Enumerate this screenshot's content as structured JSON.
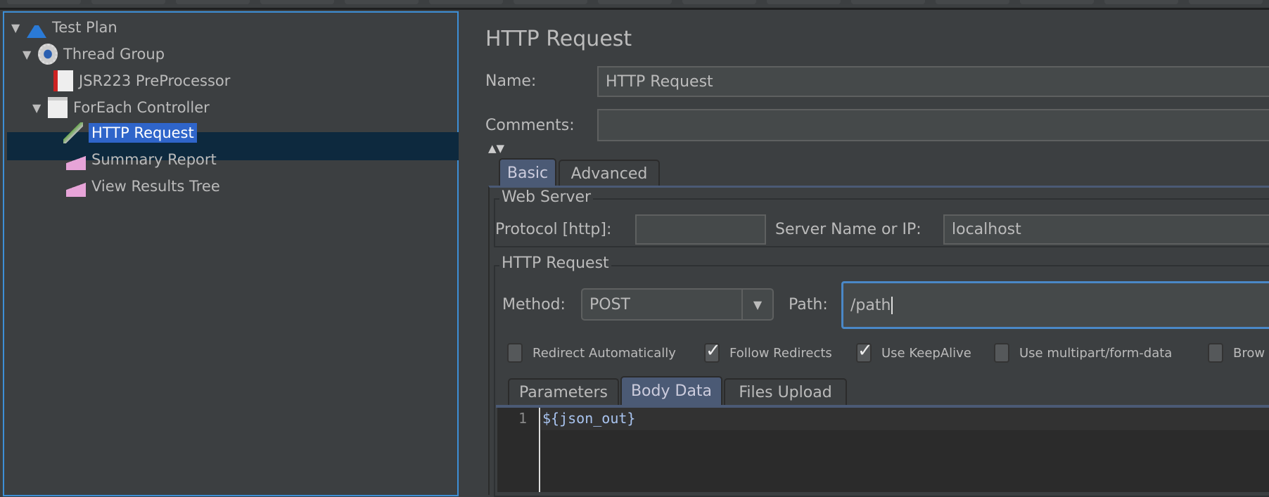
{
  "tree": {
    "items": [
      {
        "label": "Test Plan",
        "icon": "flask-icon",
        "expanded": true
      },
      {
        "label": "Thread Group",
        "icon": "gear-icon",
        "expanded": true
      },
      {
        "label": "JSR223 PreProcessor",
        "icon": "preprocessor-icon"
      },
      {
        "label": "ForEach Controller",
        "icon": "controller-icon",
        "expanded": true
      },
      {
        "label": "HTTP Request",
        "icon": "pipette-icon",
        "selected": true
      },
      {
        "label": "Summary Report",
        "icon": "report-icon"
      },
      {
        "label": "View Results Tree",
        "icon": "report-icon"
      }
    ]
  },
  "main": {
    "title": "HTTP Request",
    "name_label": "Name:",
    "name_value": "HTTP Request",
    "comments_label": "Comments:",
    "comments_value": "",
    "tabs": [
      {
        "label": "Basic",
        "active": true
      },
      {
        "label": "Advanced"
      }
    ],
    "web_server": {
      "legend": "Web Server",
      "protocol_label": "Protocol [http]:",
      "protocol_value": "",
      "server_label": "Server Name or IP:",
      "server_value": "localhost"
    },
    "http_request": {
      "legend": "HTTP Request",
      "method_label": "Method:",
      "method_value": "POST",
      "path_label": "Path:",
      "path_value": "/path"
    },
    "checkboxes": [
      {
        "label": "Redirect Automatically",
        "checked": false
      },
      {
        "label": "Follow Redirects",
        "checked": true
      },
      {
        "label": "Use KeepAlive",
        "checked": true
      },
      {
        "label": "Use multipart/form-data",
        "checked": false
      },
      {
        "label": "Brow",
        "checked": false
      }
    ],
    "subtabs": [
      {
        "label": "Parameters"
      },
      {
        "label": "Body Data",
        "active": true
      },
      {
        "label": "Files Upload"
      }
    ],
    "body": {
      "line_number": "1",
      "text": "${json_out}"
    }
  },
  "colors": {
    "selection": "#2f65ca",
    "focus": "#3d8fd6",
    "tab_active": "#4b5a75"
  }
}
